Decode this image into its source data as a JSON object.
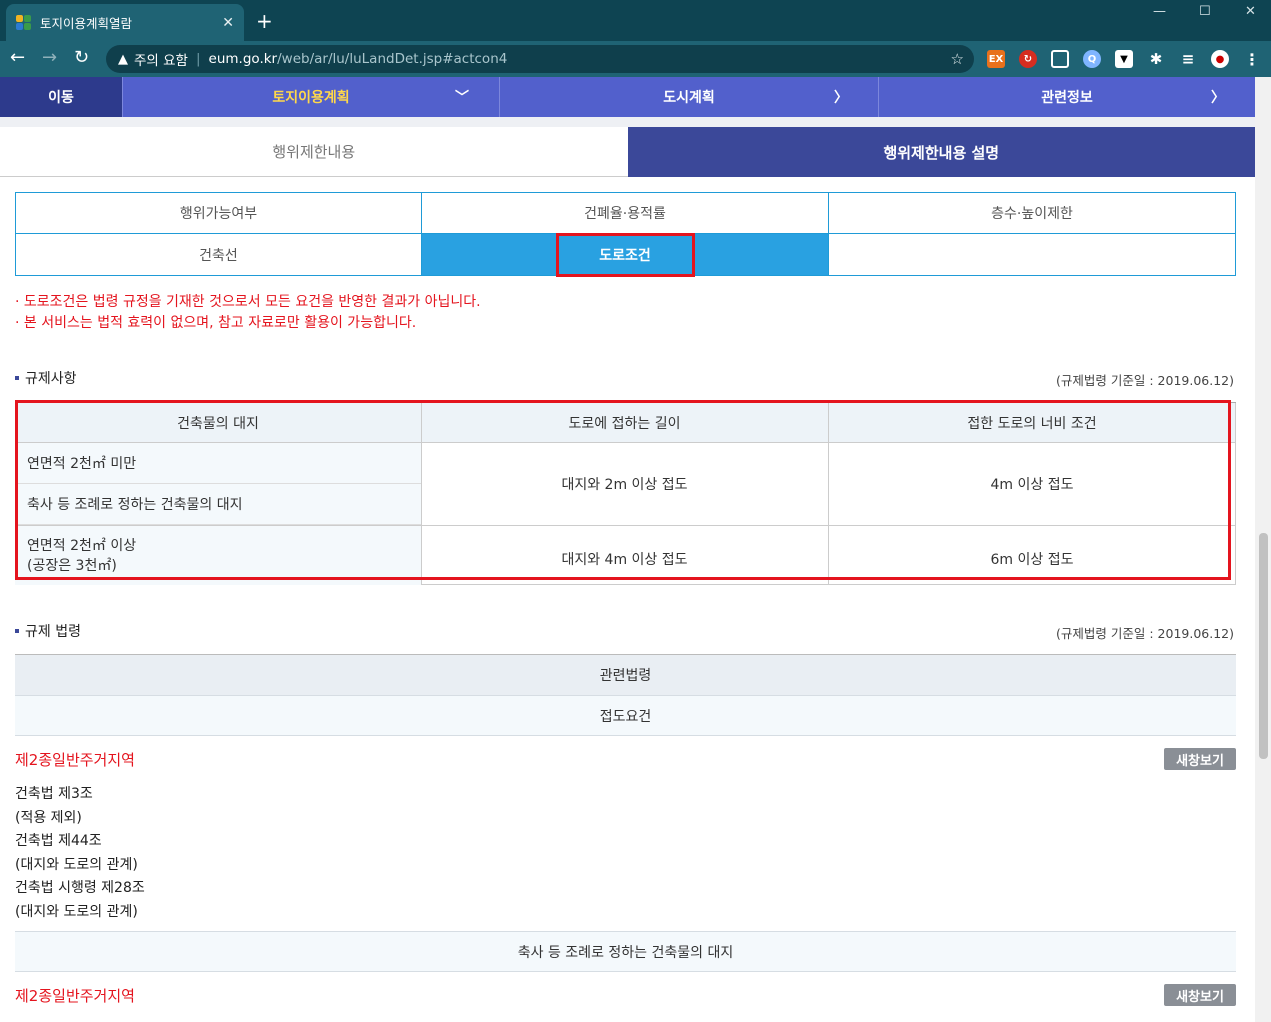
{
  "browser": {
    "tab_title": "토지이용계획열람",
    "security_label": "주의 요함",
    "url_host": "eum.go.kr",
    "url_path": "/web/ar/lu/luLandDet.jsp#actcon4"
  },
  "site_nav": {
    "move": "이동",
    "items": [
      "토지이용계획",
      "도시계획",
      "관련정보"
    ]
  },
  "content_tabs": [
    "행위제한내용",
    "행위제한내용 설명"
  ],
  "sub_tabs": [
    "행위가능여부",
    "건폐율·용적률",
    "층수·높이제한",
    "건축선",
    "도로조건",
    ""
  ],
  "notices": [
    "· 도로조건은 법령 규정을 기재한 것으로서 모든 요건을 반영한 결과가 아닙니다.",
    "· 본 서비스는 법적 효력이 없으며, 참고 자료로만 활용이 가능합니다."
  ],
  "regulations": {
    "title": "규제사항",
    "date": "(규제법령 기준일 : 2019.06.12)",
    "headers": [
      "건축물의 대지",
      "도로에 접하는 길이",
      "접한 도로의 너비 조건"
    ],
    "row1_site_a": "연면적 2천㎡ 미만",
    "row1_site_b": "축사 등 조례로 정하는 건축물의 대지",
    "row1_length": "대지와 2m 이상 접도",
    "row1_width": "4m 이상 접도",
    "row2_site_a": "연면적 2천㎡ 이상",
    "row2_site_b": "(공장은 3천㎡)",
    "row2_length": "대지와 4m 이상 접도",
    "row2_width": "6m 이상 접도"
  },
  "laws": {
    "title": "규제 법령",
    "date": "(규제법령 기준일 : 2019.06.12)",
    "header": "관련법령",
    "group1_title": "접도요건",
    "zone1": "제2종일반주거지역",
    "newwin_label": "새창보기",
    "lines": [
      "건축법 제3조",
      "(적용 제외)",
      "건축법 제44조",
      "(대지와 도로의 관계)",
      "건축법 시행령 제28조",
      "(대지와 도로의 관계)"
    ],
    "group2_title": "축사 등 조례로 정하는 건축물의 대지",
    "zone2": "제2종일반주거지역",
    "newwin_label2": "새창보기"
  },
  "colors": {
    "nav_dark": "#2d3a8c",
    "nav": "#5260cc",
    "active_tab": "#3b4899",
    "selected_subtab": "#29a1e1",
    "highlight": "#e4141e"
  }
}
